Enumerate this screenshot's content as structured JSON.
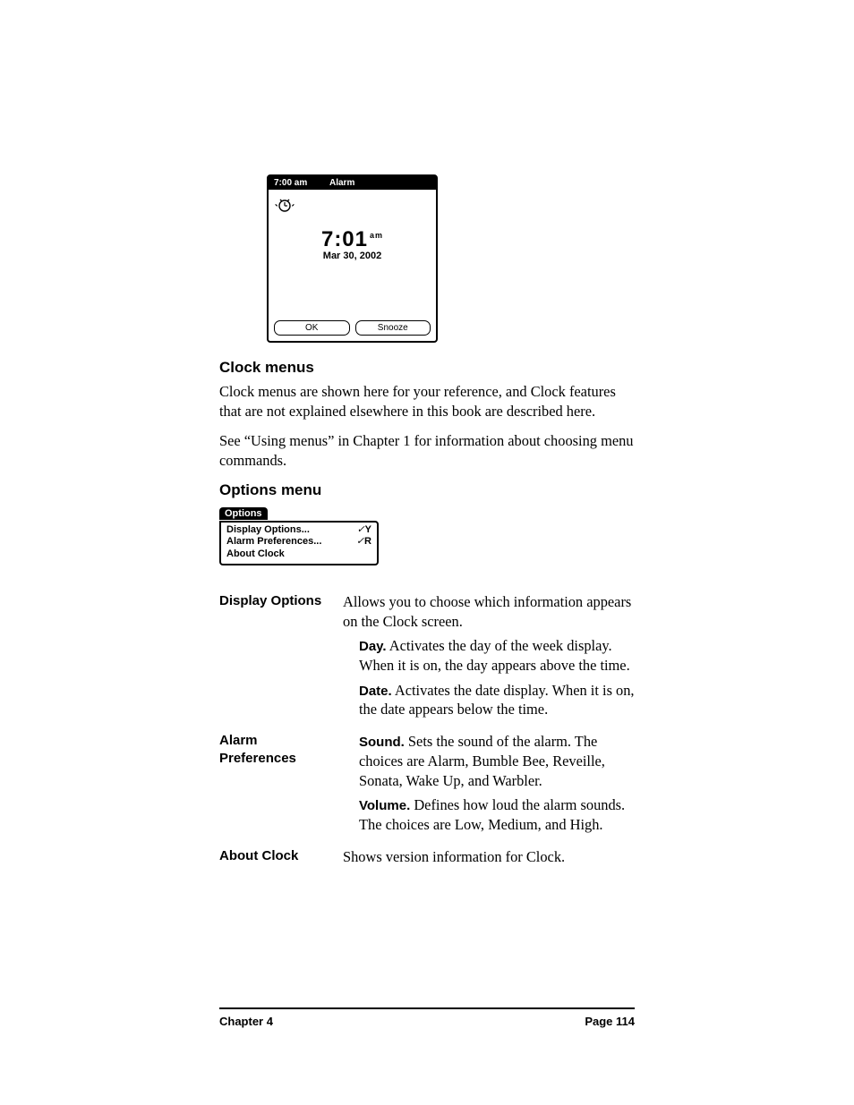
{
  "alarm_screenshot": {
    "top_time": "7:00 am",
    "top_title": "Alarm",
    "big_time": "7:01",
    "ampm": "am",
    "date": "Mar 30, 2002",
    "ok": "OK",
    "snooze": "Snooze"
  },
  "h1": "Clock menus",
  "p1": "Clock menus are shown here for your reference, and Clock features that are not explained elsewhere in this book are described here.",
  "p2": "See “Using menus” in Chapter 1 for information about choosing menu commands.",
  "h2": "Options menu",
  "options_menu": {
    "tab": "Options",
    "items": [
      {
        "label": "Display Options...",
        "shortcut": "Y"
      },
      {
        "label": "Alarm Preferences...",
        "shortcut": "R"
      },
      {
        "label": "About Clock",
        "shortcut": ""
      }
    ]
  },
  "defs": {
    "display_options": {
      "term": "Display Options",
      "intro": "Allows you to choose which information appears on the Clock screen.",
      "day_label": "Day.",
      "day_text": " Activates the day of the week display. When it is on, the day appears above the time.",
      "date_label": "Date.",
      "date_text": " Activates the date display. When it is on, the date appears below the time."
    },
    "alarm_prefs": {
      "term": "Alarm Preferences",
      "sound_label": "Sound.",
      "sound_text": " Sets the sound of the alarm. The choices are Alarm, Bumble Bee, Reveille, Sonata, Wake Up, and Warbler.",
      "volume_label": "Volume.",
      "volume_text": " Defines how loud the alarm sounds. The choices are Low, Medium, and High."
    },
    "about_clock": {
      "term": "About Clock",
      "text": "Shows version information for Clock."
    }
  },
  "footer": {
    "left": "Chapter 4",
    "right": "Page 114"
  }
}
